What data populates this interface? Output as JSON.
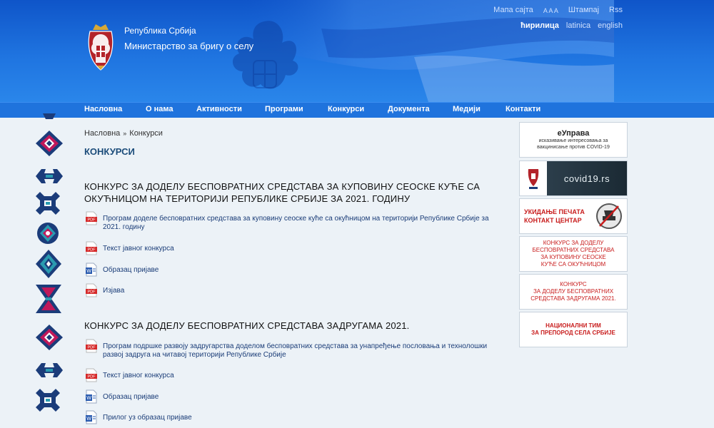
{
  "header": {
    "top_links": [
      "Мапа сајта",
      "A A A",
      "Штампај",
      "Rss"
    ],
    "languages": [
      "ћирилица",
      "latinica",
      "english"
    ],
    "logo_line1": "Република Србија",
    "logo_line2": "Министарство за бригу о селу"
  },
  "nav": {
    "items": [
      "Насловна",
      "О нама",
      "Активности",
      "Програми",
      "Конкурси",
      "Документа",
      "Медији",
      "Контакти"
    ]
  },
  "breadcrumb": {
    "home": "Насловна",
    "separator": "»",
    "current": "Конкурси"
  },
  "page_title": "КОНКУРСИ",
  "sections": [
    {
      "title": "КОНКУРС ЗА ДОДЕЛУ БЕСПОВРАТНИХ СРЕДСТАВА ЗА КУПОВИНУ СЕОСКЕ КУЋЕ СА ОКУЋНИЦОМ НА ТЕРИТОРИЈИ РЕПУБЛИКЕ СРБИЈЕ ЗА 2021. ГОДИНУ",
      "docs": [
        {
          "type": "pdf",
          "label": "Програм доделе бесповратних средстава за куповину сеоске куће са окућницом на територији Републике Србије за 2021. годину"
        },
        {
          "type": "pdf",
          "label": "Текст јавног конкурса"
        },
        {
          "type": "word",
          "label": "Образац пријаве"
        },
        {
          "type": "pdf",
          "label": "Изјава"
        }
      ]
    },
    {
      "title": "КОНКУРС ЗА ДОДЕЛУ БЕСПОВРАТНИХ СРЕДСТАВА ЗАДРУГАМА 2021.",
      "docs": [
        {
          "type": "pdf",
          "label": "Програм подршке развоју задругарства доделом бесповратних средстава за унапређење пословања и технолошки развој задруга на читавој територији Републике Србије"
        },
        {
          "type": "pdf",
          "label": "Текст јавног конкурса"
        },
        {
          "type": "word",
          "label": "Образац пријаве"
        },
        {
          "type": "word",
          "label": "Прилог уз образац пријаве"
        }
      ]
    }
  ],
  "sidebar": {
    "banners": [
      {
        "id": "euprava",
        "line1": "еУправа",
        "line2": "исказивање интересовања за",
        "line3": "вакцинисање против COVID-19"
      },
      {
        "id": "covid",
        "label": "covid19.rs"
      },
      {
        "id": "stamp",
        "line1": "УКИДАЊЕ ПЕЧАТА",
        "line2": "КОНТАКТ ЦЕНТАР"
      },
      {
        "id": "konkurs-kuca",
        "line1": "КОНКУРС ЗА ДОДЕЛУ",
        "line2": "БЕСПОВРАТНИХ СРЕДСТАВА",
        "line3": "ЗА КУПОВИНУ СЕОСКЕ",
        "line4": "КУЋЕ СА ОКУЋНИЦОМ"
      },
      {
        "id": "konkurs-zadruge",
        "line1": "КОНКУРС",
        "line2": "ЗА ДОДЕЛУ БЕСПОВРАТНИХ",
        "line3": "СРЕДСТАВА ЗАДРУГАМА 2021."
      },
      {
        "id": "nacionalni-tim",
        "line1": "НАЦИОНАЛНИ ТИМ",
        "line2": "ЗА ПРЕПОРОД СЕЛА СРБИЈЕ"
      }
    ]
  },
  "colors": {
    "header_blue": "#1a6adb",
    "nav_blue": "#1f73dd",
    "page_bg": "#ecf2f7",
    "title_blue": "#1b4c7a",
    "link_blue": "#1b3d78",
    "banner_red": "#c81c1c",
    "ornament_primary": "#1b3c7a",
    "ornament_accent": "#c0185a"
  }
}
